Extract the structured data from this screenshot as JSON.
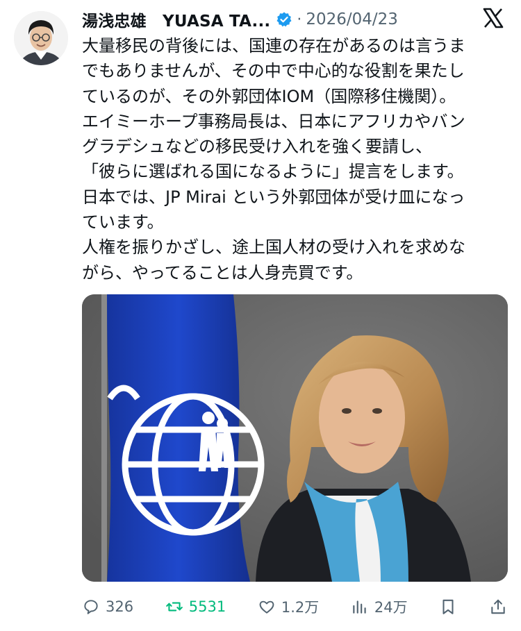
{
  "author": {
    "display_name": "湯浅忠雄　YUASA TA...",
    "verified": true,
    "separator": "·",
    "date": "2026/04/23"
  },
  "platform_icon": "x-logo-icon",
  "tweet": {
    "lines": [
      "大量移民の背後には、国連の存在があるのは言うま",
      "でもありませんが、その中で中心的な役割を果たし",
      "ているのが、その外郭団体IOM（国際移住機関）。",
      "エイミーホープ事務局長は、日本にアフリカやバン",
      "グラデシュなどの移民受け入れを強く要請し、",
      "「彼らに選ばれる国になるように」提言をします。",
      "日本では、JP Mirai という外郭団体が受け皿になっ",
      "ています。",
      "人権を振りかざし、途上国人材の受け入れを求めな",
      "がら、やってることは人身売買です。"
    ]
  },
  "media": {
    "flag_color": "#1b3fbf",
    "scarf_color": "#4ea9d8"
  },
  "actions": {
    "reply_count": "326",
    "retweet_count": "5531",
    "like_count": "1.2万",
    "view_count": "24万"
  },
  "colors": {
    "text": "#0f1419",
    "muted": "#536471",
    "verified": "#1d9bf0",
    "retweet": "#00ba7c"
  }
}
